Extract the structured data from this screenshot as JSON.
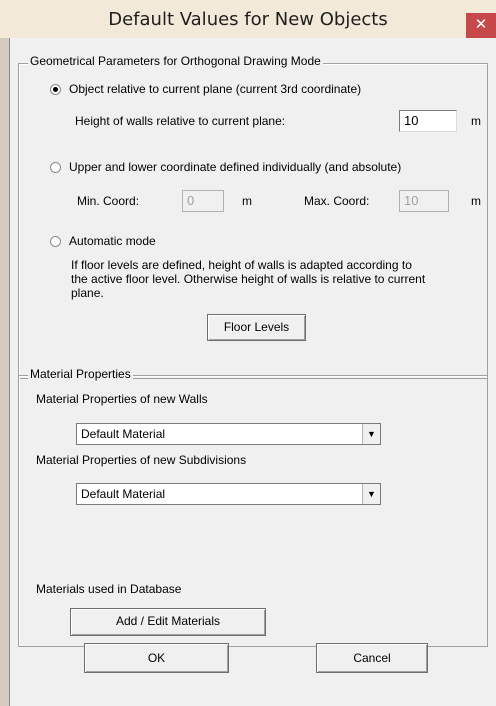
{
  "dialog": {
    "title": "Default Values for New Objects",
    "close_glyph": "✕",
    "ok_label": "OK",
    "cancel_label": "Cancel"
  },
  "geometry": {
    "legend": "Geometrical Parameters for Orthogonal Drawing Mode",
    "option_relative": {
      "label": "Object relative to current plane (current 3rd coordinate)",
      "selected": true
    },
    "height_label": "Height of walls relative to current plane:",
    "height_value": "10",
    "height_unit": "m",
    "option_absolute": {
      "label": "Upper and lower coordinate defined individually (and absolute)",
      "selected": false
    },
    "min_label": "Min. Coord:",
    "min_value": "0",
    "min_unit": "m",
    "max_label": "Max. Coord:",
    "max_value": "10",
    "max_unit": "m",
    "option_auto": {
      "label": "Automatic mode",
      "selected": false
    },
    "auto_desc_lines": [
      "If floor levels are defined,  height of walls is adapted according to",
      "the active floor level. Otherwise height of walls is relative to current",
      "plane."
    ],
    "floor_levels_label": "Floor Levels"
  },
  "materials": {
    "legend": "Material Properties",
    "walls_label": "Material Properties of new Walls",
    "walls_value": "Default Material",
    "subdivisions_label": "Material Properties of new Subdivisions",
    "subdivisions_value": "Default Material",
    "database_label": "Materials used in Database",
    "add_edit_label": "Add / Edit Materials"
  },
  "icons": {
    "dropdown": "▼"
  }
}
